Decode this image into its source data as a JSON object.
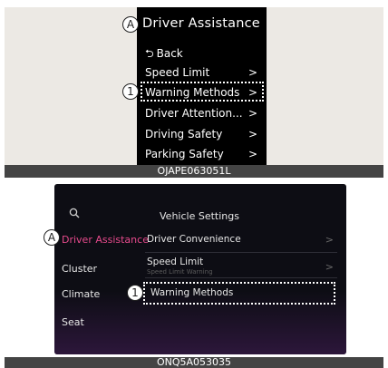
{
  "top": {
    "title": "Driver Assistance",
    "callout_a": "A",
    "callout_1": "1",
    "menu": [
      {
        "label": "Back",
        "chevron": "",
        "icon": "back-arrow-icon"
      },
      {
        "label": "Speed Limit",
        "chevron": ">"
      },
      {
        "label": "Warning Methods",
        "chevron": ">"
      },
      {
        "label": "Driver Attention...",
        "chevron": ">"
      },
      {
        "label": "Driving Safety",
        "chevron": ">"
      },
      {
        "label": "Parking Safety",
        "chevron": ">"
      }
    ],
    "caption": "OJAPE063051L"
  },
  "bottom": {
    "title": "Vehicle Settings",
    "search_icon": "search-icon",
    "callout_a": "A",
    "callout_1": "1",
    "sidebar": [
      {
        "label": "Driver Assistance",
        "active": true
      },
      {
        "label": "Cluster",
        "active": false
      },
      {
        "label": "Climate",
        "active": false
      },
      {
        "label": "Seat",
        "active": false
      }
    ],
    "rows": [
      {
        "label": "Driver Convenience",
        "sub": "",
        "chevron": ">"
      },
      {
        "label": "Speed Limit",
        "sub": "Speed Limit Warning",
        "chevron": ">"
      },
      {
        "label": "Warning Methods",
        "sub": "",
        "chevron": ""
      }
    ],
    "caption": "ONQ5A053035"
  },
  "colors": {
    "active_sidebar": "#e64a8c",
    "screen_bg": "#000000",
    "panel_bg": "#ece9e4",
    "caption_bg": "#444444"
  }
}
